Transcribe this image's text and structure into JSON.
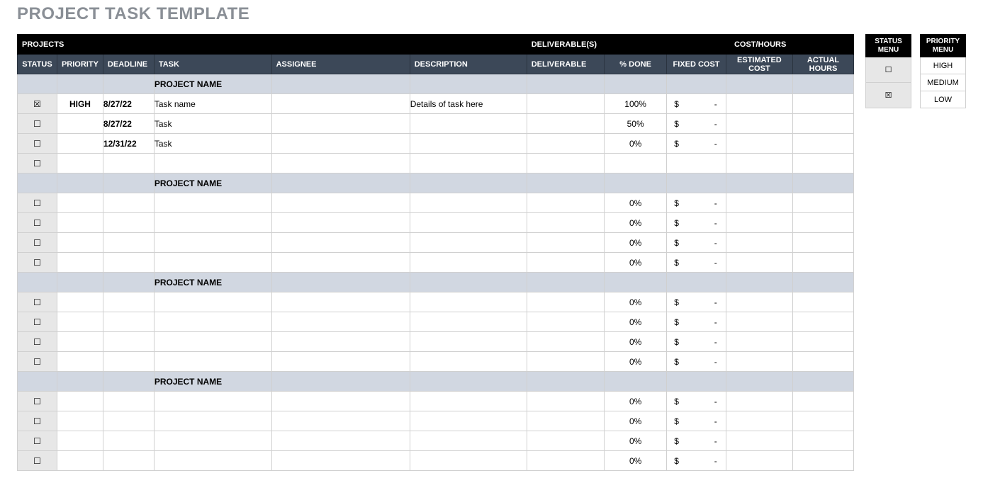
{
  "title": "PROJECT TASK TEMPLATE",
  "topBand": {
    "projects": "PROJECTS",
    "deliverables": "DELIVERABLE(S)",
    "costhours": "COST/HOURS"
  },
  "columns": {
    "status": "STATUS",
    "priority": "PRIORITY",
    "deadline": "DEADLINE",
    "task": "TASK",
    "assignee": "ASSIGNEE",
    "description": "DESCRIPTION",
    "deliverable": "DELIVERABLE",
    "done": "% DONE",
    "fixed": "FIXED COST",
    "est": "ESTIMATED COST",
    "actual": "ACTUAL HOURS"
  },
  "sectionLabel": "PROJECT NAME",
  "glyph": {
    "unchecked": "☐",
    "checked": "☒",
    "dollar": "$",
    "dash": "-"
  },
  "groups": [
    {
      "rows": [
        {
          "status": "checked",
          "priority": "HIGH",
          "deadline": "8/27/22",
          "task": "Task name",
          "assignee": "",
          "description": "Details of task here",
          "deliverable": "",
          "done": "100%",
          "fixed": true,
          "est": "",
          "actual": ""
        },
        {
          "status": "unchecked",
          "priority": "",
          "deadline": "8/27/22",
          "task": "Task",
          "assignee": "",
          "description": "",
          "deliverable": "",
          "done": "50%",
          "fixed": true,
          "est": "",
          "actual": ""
        },
        {
          "status": "unchecked",
          "priority": "",
          "deadline": "12/31/22",
          "task": "Task",
          "assignee": "",
          "description": "",
          "deliverable": "",
          "done": "0%",
          "fixed": true,
          "est": "",
          "actual": ""
        },
        {
          "status": "unchecked",
          "priority": "",
          "deadline": "",
          "task": "",
          "assignee": "",
          "description": "",
          "deliverable": "",
          "done": "",
          "fixed": false,
          "est": "",
          "actual": ""
        }
      ]
    },
    {
      "rows": [
        {
          "status": "unchecked",
          "priority": "",
          "deadline": "",
          "task": "",
          "assignee": "",
          "description": "",
          "deliverable": "",
          "done": "0%",
          "fixed": true,
          "est": "",
          "actual": ""
        },
        {
          "status": "unchecked",
          "priority": "",
          "deadline": "",
          "task": "",
          "assignee": "",
          "description": "",
          "deliverable": "",
          "done": "0%",
          "fixed": true,
          "est": "",
          "actual": ""
        },
        {
          "status": "unchecked",
          "priority": "",
          "deadline": "",
          "task": "",
          "assignee": "",
          "description": "",
          "deliverable": "",
          "done": "0%",
          "fixed": true,
          "est": "",
          "actual": ""
        },
        {
          "status": "unchecked",
          "priority": "",
          "deadline": "",
          "task": "",
          "assignee": "",
          "description": "",
          "deliverable": "",
          "done": "0%",
          "fixed": true,
          "est": "",
          "actual": ""
        }
      ]
    },
    {
      "rows": [
        {
          "status": "unchecked",
          "priority": "",
          "deadline": "",
          "task": "",
          "assignee": "",
          "description": "",
          "deliverable": "",
          "done": "0%",
          "fixed": true,
          "est": "",
          "actual": ""
        },
        {
          "status": "unchecked",
          "priority": "",
          "deadline": "",
          "task": "",
          "assignee": "",
          "description": "",
          "deliverable": "",
          "done": "0%",
          "fixed": true,
          "est": "",
          "actual": ""
        },
        {
          "status": "unchecked",
          "priority": "",
          "deadline": "",
          "task": "",
          "assignee": "",
          "description": "",
          "deliverable": "",
          "done": "0%",
          "fixed": true,
          "est": "",
          "actual": ""
        },
        {
          "status": "unchecked",
          "priority": "",
          "deadline": "",
          "task": "",
          "assignee": "",
          "description": "",
          "deliverable": "",
          "done": "0%",
          "fixed": true,
          "est": "",
          "actual": ""
        }
      ]
    },
    {
      "rows": [
        {
          "status": "unchecked",
          "priority": "",
          "deadline": "",
          "task": "",
          "assignee": "",
          "description": "",
          "deliverable": "",
          "done": "0%",
          "fixed": true,
          "est": "",
          "actual": ""
        },
        {
          "status": "unchecked",
          "priority": "",
          "deadline": "",
          "task": "",
          "assignee": "",
          "description": "",
          "deliverable": "",
          "done": "0%",
          "fixed": true,
          "est": "",
          "actual": ""
        },
        {
          "status": "unchecked",
          "priority": "",
          "deadline": "",
          "task": "",
          "assignee": "",
          "description": "",
          "deliverable": "",
          "done": "0%",
          "fixed": true,
          "est": "",
          "actual": ""
        },
        {
          "status": "unchecked",
          "priority": "",
          "deadline": "",
          "task": "",
          "assignee": "",
          "description": "",
          "deliverable": "",
          "done": "0%",
          "fixed": true,
          "est": "",
          "actual": ""
        }
      ]
    }
  ],
  "statusMenu": {
    "title": "STATUS MENU",
    "items": [
      "unchecked",
      "checked"
    ]
  },
  "priorityMenu": {
    "title": "PRIORITY MENU",
    "items": [
      "HIGH",
      "MEDIUM",
      "LOW"
    ]
  }
}
